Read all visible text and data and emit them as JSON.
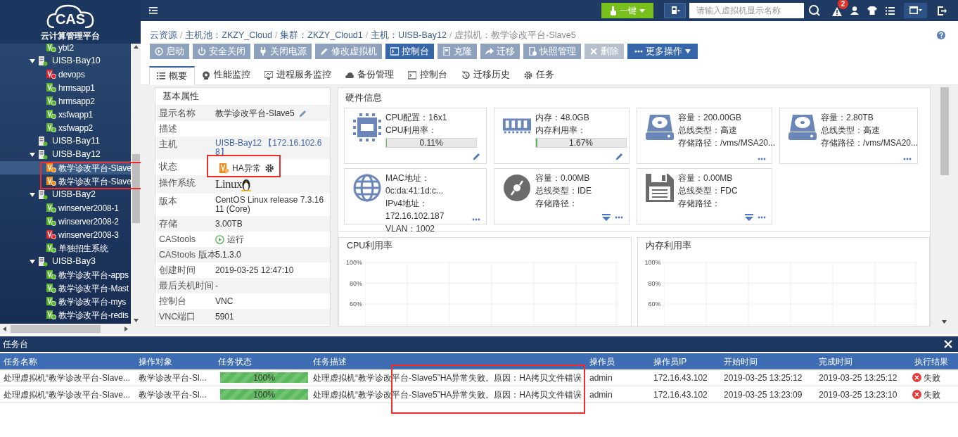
{
  "logo": {
    "mark": "CAS",
    "subtitle": "云计算管理平台"
  },
  "tree": [
    {
      "label": "ybt2",
      "kind": "vm",
      "color": "#58b62a",
      "selected": false
    },
    {
      "label": "UISB-Bay10",
      "kind": "host",
      "expanded": true,
      "selected": false,
      "children": [
        {
          "label": "devops",
          "kind": "vm",
          "color": "#e0262f",
          "selected": false
        },
        {
          "label": "hrmsapp1",
          "kind": "vm",
          "color": "#58b62a",
          "selected": false
        },
        {
          "label": "hrmsapp2",
          "kind": "vm",
          "color": "#58b62a",
          "selected": false
        },
        {
          "label": "xsfwapp1",
          "kind": "vm",
          "color": "#58b62a",
          "selected": false
        },
        {
          "label": "xsfwapp2",
          "kind": "vm",
          "color": "#58b62a",
          "selected": false
        }
      ]
    },
    {
      "label": "UISB-Bay11",
      "kind": "host",
      "expanded": false,
      "selected": false
    },
    {
      "label": "UISB-Bay12",
      "kind": "host",
      "expanded": true,
      "selected": false,
      "children": [
        {
          "label": "教学诊改平台-Slave",
          "kind": "vm",
          "color": "#f08c1a",
          "selected": true
        },
        {
          "label": "教学诊改平台-Slave",
          "kind": "vm",
          "color": "#f08c1a",
          "selected": false
        }
      ]
    },
    {
      "label": "UISB-Bay2",
      "kind": "host",
      "expanded": true,
      "selected": false,
      "children": [
        {
          "label": "winserver2008-1",
          "kind": "vm",
          "color": "#58b62a",
          "selected": false
        },
        {
          "label": "winserver2008-2",
          "kind": "vm",
          "color": "#58b62a",
          "selected": false
        },
        {
          "label": "winserver2008-3",
          "kind": "vm",
          "color": "#e0262f",
          "selected": false
        },
        {
          "label": "单独招生系统",
          "kind": "vm",
          "color": "#58b62a",
          "selected": false
        }
      ]
    },
    {
      "label": "UISB-Bay3",
      "kind": "host",
      "expanded": true,
      "selected": false,
      "children": [
        {
          "label": "教学诊改平台-apps",
          "kind": "vm",
          "color": "#58b62a",
          "selected": false
        },
        {
          "label": "教学诊改平台-Mast",
          "kind": "vm",
          "color": "#58b62a",
          "selected": false
        },
        {
          "label": "教学诊改平台-mys",
          "kind": "vm",
          "color": "#58b62a",
          "selected": false
        },
        {
          "label": "教学诊改平台-redis",
          "kind": "vm",
          "color": "#58b62a",
          "selected": false
        }
      ]
    }
  ],
  "topbar": {
    "one_click": "一键",
    "search": {
      "placeholder": "请输入虚拟机显示名称"
    },
    "alert_count": "2"
  },
  "breadcrumb_separator": "/",
  "breadcrumb": [
    {
      "text": "云资源",
      "current": false
    },
    {
      "text": "主机池：ZKZY_Cloud",
      "current": false
    },
    {
      "text": "集群：ZKZY_Cloud1",
      "current": false
    },
    {
      "text": "主机：UISB-Bay12",
      "current": false
    },
    {
      "text": "虚拟机：教学诊改平台-Slave5",
      "current": true
    }
  ],
  "actions": [
    {
      "label": "启动",
      "kind": "default"
    },
    {
      "label": "安全关闭",
      "kind": "default"
    },
    {
      "label": "关闭电源",
      "kind": "default"
    },
    {
      "label": "修改虚拟机",
      "kind": "default"
    },
    {
      "label": "控制台",
      "kind": "primary"
    },
    {
      "label": "克隆",
      "kind": "default"
    },
    {
      "label": "迁移",
      "kind": "default"
    },
    {
      "label": "快照管理",
      "kind": "default"
    },
    {
      "label": "删除",
      "kind": "disabled"
    },
    {
      "label": "更多操作",
      "kind": "menu"
    }
  ],
  "tabs": [
    {
      "label": "概要",
      "selected": true
    },
    {
      "label": "性能监控",
      "selected": false
    },
    {
      "label": "进程服务监控",
      "selected": false
    },
    {
      "label": "备份管理",
      "selected": false
    },
    {
      "label": "控制台",
      "selected": false
    },
    {
      "label": "迁移历史",
      "selected": false
    },
    {
      "label": "任务",
      "selected": false
    }
  ],
  "properties": {
    "title": "基本属性",
    "rows": [
      {
        "label": "显示名称",
        "kind": "editable",
        "value": "教学诊改平台-Slave5"
      },
      {
        "label": "描述",
        "kind": "text"
      },
      {
        "label": "主机",
        "kind": "link",
        "value": "UISB-Bay12 【172.16.102.68】"
      },
      {
        "label": "状态",
        "kind": "status",
        "value": "HA异常"
      },
      {
        "label": "操作系统",
        "kind": "os",
        "value": "Linux"
      },
      {
        "label": "版本",
        "kind": "text",
        "value": "CentOS Linux release 7.3.1611 (Core)"
      },
      {
        "label": "存储",
        "kind": "text",
        "value": "3.00TB"
      },
      {
        "label": "CAStools",
        "kind": "running",
        "value": "运行"
      },
      {
        "label": "CAStools 版本",
        "kind": "text",
        "value": "5.1.3.0"
      },
      {
        "label": "创建时间",
        "kind": "text",
        "value": "2019-03-25 12:47:10"
      },
      {
        "label": "最后关机时间",
        "kind": "text",
        "value": "-"
      },
      {
        "label": "控制台",
        "kind": "text",
        "value": "VNC"
      },
      {
        "label": "VNC端口",
        "kind": "text",
        "value": "5901"
      }
    ]
  },
  "hardware": {
    "title": "硬件信息",
    "cards": [
      {
        "kind": "cpu",
        "lines": [
          "CPU配置：16x1",
          "CPU利用率："
        ],
        "meter": {
          "level": 0.0011,
          "reading": "0.11%"
        },
        "edit": true,
        "filter": false,
        "more": false
      },
      {
        "kind": "memory",
        "lines": [
          "内存：48.0GB",
          "内存利用率："
        ],
        "meter": {
          "level": 0.0167,
          "reading": "1.67%"
        },
        "edit": true,
        "filter": false,
        "more": false
      },
      {
        "kind": "disk",
        "lines": [
          "容量：200.00GB",
          "总线类型：高速",
          "存储路径：/vms/MSA20..."
        ],
        "edit": false,
        "filter": false,
        "more": true
      },
      {
        "kind": "disk",
        "lines": [
          "容量：2.80TB",
          "总线类型：高速",
          "存储路径：/vms/MSA20..."
        ],
        "edit": false,
        "filter": false,
        "more": true
      },
      {
        "kind": "network",
        "lines": [
          "MAC地址：",
          "0c:da:41:1d:c...",
          "IPv4地址：",
          "172.16.102.187",
          "VLAN：1002"
        ],
        "edit": false,
        "filter": false,
        "more": true
      },
      {
        "kind": "cdrom",
        "lines": [
          "容量：0.00MB",
          "总线类型：IDE",
          "存储路径："
        ],
        "edit": false,
        "filter": true,
        "more": true
      },
      {
        "kind": "floppy",
        "lines": [
          "容量：0.00MB",
          "总线类型：FDC",
          "存储路径："
        ],
        "edit": false,
        "filter": true,
        "more": true
      }
    ]
  },
  "charts": [
    {
      "title": "CPU利用率",
      "y_labels": [
        "100%",
        "80%",
        "60%"
      ]
    },
    {
      "title": "内存利用率",
      "y_labels": [
        "100%",
        "80%",
        "60%"
      ]
    }
  ],
  "tasks": {
    "title": "任务台",
    "columns": [
      "任务名称",
      "操作对象",
      "任务状态",
      "任务描述",
      "操作员",
      "操作员IP",
      "开始时间",
      "完成时间",
      "执行结果"
    ],
    "rows": [
      {
        "name": "处理虚拟机“教学诊改平台-Slave...",
        "target": "教学诊改平台-Sl...",
        "progress": {
          "level": 1,
          "reading": "100%"
        },
        "description": "处理虚拟机“教学诊改平台-Slave5”HA异常失败。原因：HA拷贝文件错误",
        "operator": "admin",
        "operator_ip": "172.16.43.102",
        "start": "2019-03-25 13:25:12",
        "end": "2019-03-25 13:25:12",
        "result": {
          "kind": "failed",
          "text": "失败"
        }
      },
      {
        "name": "处理虚拟机“教学诊改平台-Slave...",
        "target": "教学诊改平台-Sl...",
        "progress": {
          "level": 1,
          "reading": "100%"
        },
        "description": "处理虚拟机“教学诊改平台-Slave5”HA异常失败。原因：HA拷贝文件错误",
        "operator": "admin",
        "operator_ip": "172.16.43.102",
        "start": "2019-03-25 13:23:09",
        "end": "2019-03-25 13:23:10",
        "result": {
          "kind": "failed",
          "text": "失败"
        }
      }
    ]
  }
}
